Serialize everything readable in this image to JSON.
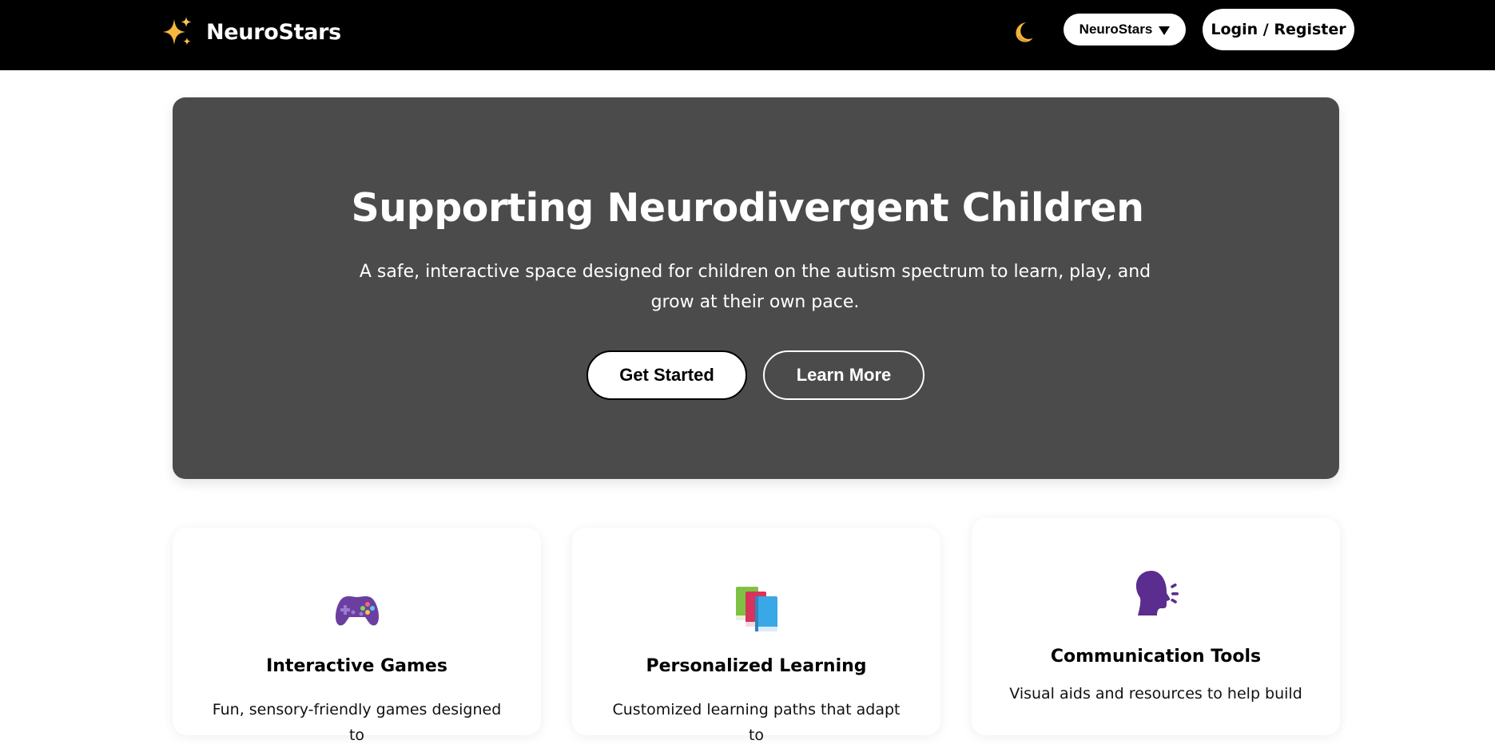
{
  "navbar": {
    "brand_name": "NeuroStars",
    "brand_icon": "sparkles-icon",
    "theme_toggle_icon": "crescent-moon-icon",
    "language_select": {
      "selected": "NeuroStars",
      "icon": "caret-down-icon"
    },
    "login_label": "Login / Register"
  },
  "hero": {
    "title": "Supporting Neurodivergent Children",
    "subtitle": "A safe, interactive space designed for children on the autism spectrum to learn, play, and grow at their own pace.",
    "primary_button": "Get Started",
    "secondary_button": "Learn More"
  },
  "features": [
    {
      "icon": "game-controller-icon",
      "title": "Interactive Games",
      "description": "Fun, sensory-friendly games designed to"
    },
    {
      "icon": "books-icon",
      "title": "Personalized Learning",
      "description": "Customized learning paths that adapt to"
    },
    {
      "icon": "speaking-head-icon",
      "title": "Communication Tools",
      "description": "Visual aids and resources to help build"
    }
  ],
  "colors": {
    "navbar_bg": "#000000",
    "hero_bg": "#4b4b4b",
    "page_bg": "#ffffff",
    "sparkle_gold": "#f6b73c",
    "moon_yellow": "#f2b53a",
    "controller_purple": "#6b3fa0",
    "speaker_purple": "#5b2d8e"
  }
}
